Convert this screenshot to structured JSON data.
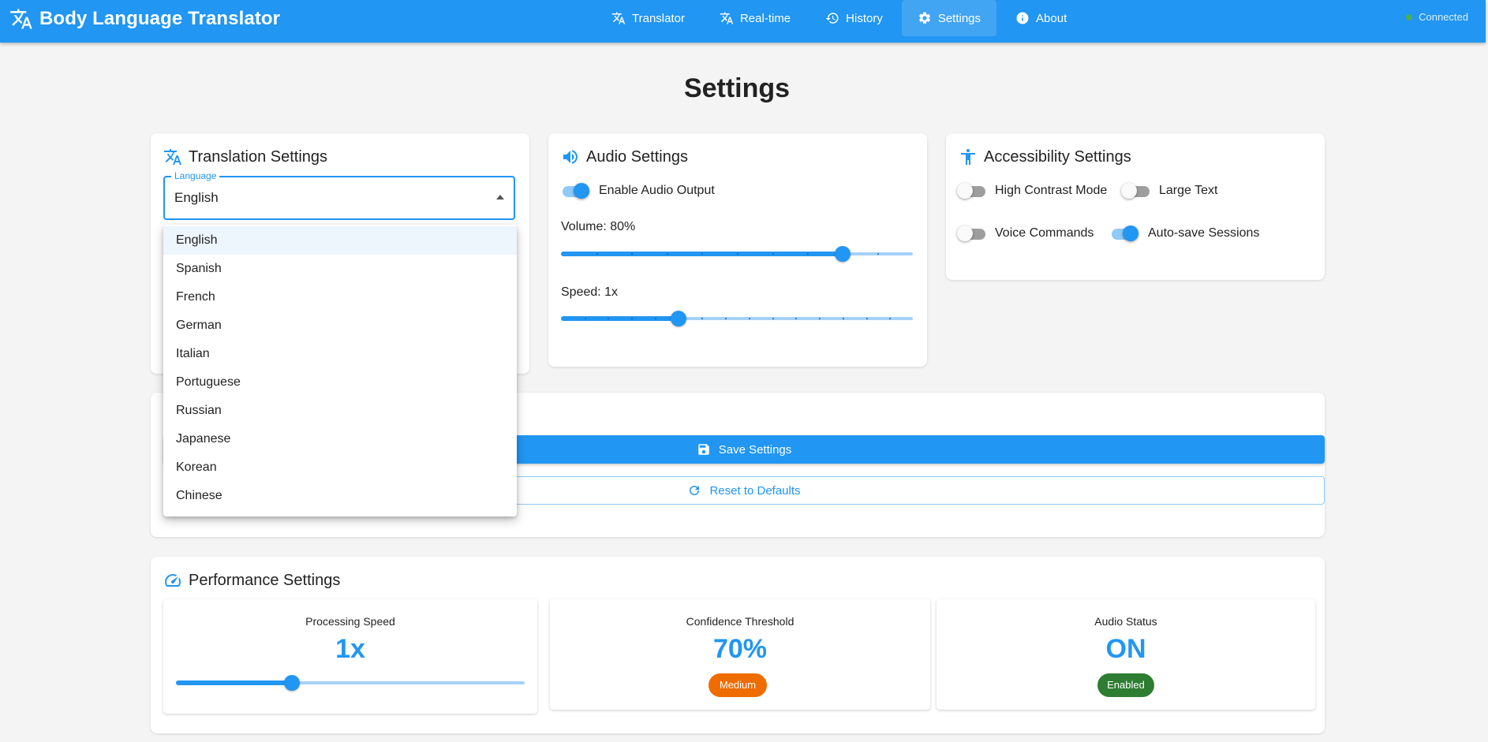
{
  "app": {
    "title": "Body Language Translator",
    "status": "Connected",
    "nav": [
      {
        "label": "Translator",
        "icon": "translate-icon"
      },
      {
        "label": "Real-time",
        "icon": "translate-icon"
      },
      {
        "label": "History",
        "icon": "history-icon"
      },
      {
        "label": "Settings",
        "icon": "gear-icon",
        "active": true
      },
      {
        "label": "About",
        "icon": "info-icon"
      }
    ]
  },
  "page": {
    "title": "Settings"
  },
  "translation": {
    "heading": "Translation Settings",
    "language_label": "Language",
    "language_value": "English",
    "options": [
      "English",
      "Spanish",
      "French",
      "German",
      "Italian",
      "Portuguese",
      "Russian",
      "Japanese",
      "Korean",
      "Chinese"
    ]
  },
  "audio": {
    "heading": "Audio Settings",
    "enable_label": "Enable Audio Output",
    "enable_on": true,
    "volume_label": "Volume: 80%",
    "volume_fraction": 0.8,
    "speed_label": "Speed: 1x",
    "speed_fraction": 0.333
  },
  "accessibility": {
    "heading": "Accessibility Settings",
    "high_contrast": "High Contrast Mode",
    "large_text": "Large Text",
    "voice_commands": "Voice Commands",
    "auto_save": "Auto-save Sessions",
    "states": {
      "high_contrast": false,
      "large_text": false,
      "voice_commands": false,
      "auto_save": true
    }
  },
  "actions": {
    "save": "Save Settings",
    "reset": "Reset to Defaults"
  },
  "performance": {
    "heading": "Performance Settings",
    "processing_title": "Processing Speed",
    "processing_value": "1x",
    "processing_fraction": 0.333,
    "confidence_title": "Confidence Threshold",
    "confidence_value": "70%",
    "confidence_badge": "Medium",
    "audio_title": "Audio Status",
    "audio_value": "ON",
    "audio_badge": "Enabled"
  },
  "colors": {
    "primary": "#2196f3",
    "medium_badge": "#ef6c00",
    "enabled_badge": "#2e7d32",
    "connected_dot": "#4caf50"
  }
}
